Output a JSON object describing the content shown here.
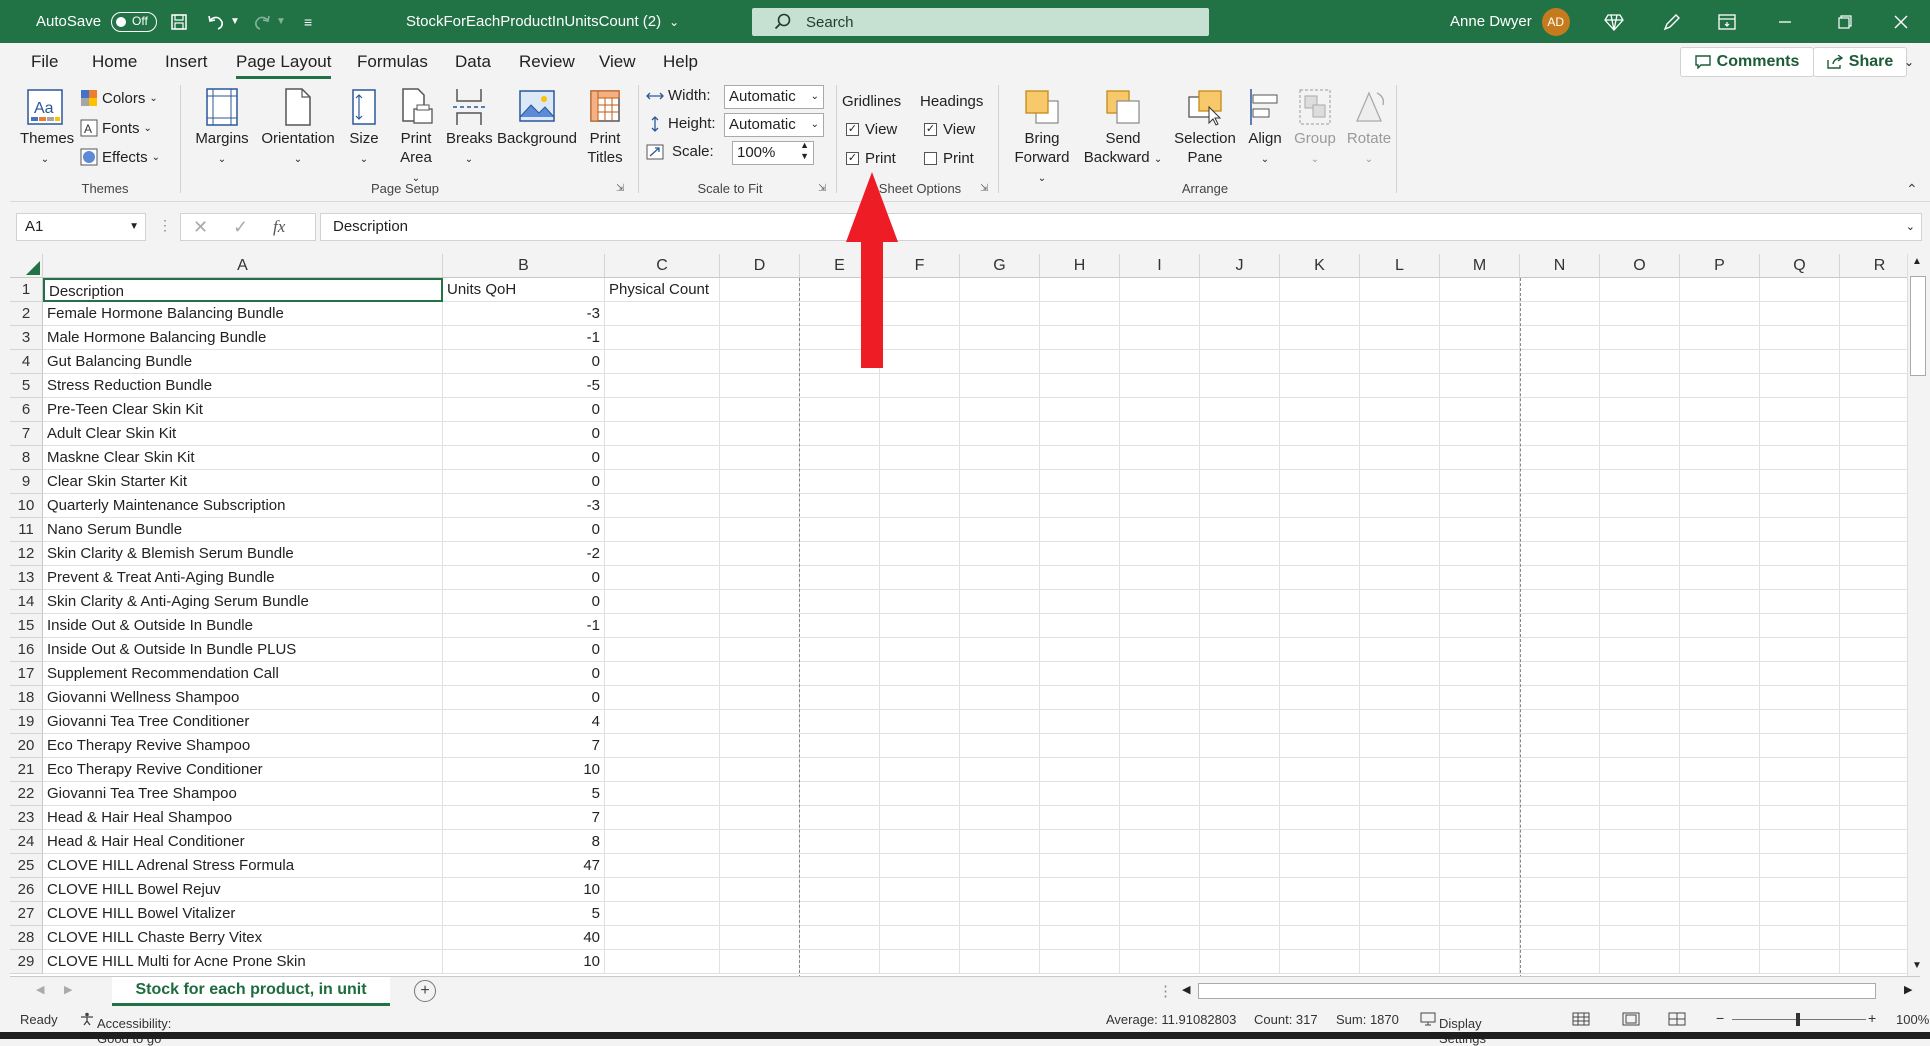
{
  "titlebar": {
    "autosave_label": "AutoSave",
    "autosave_state": "Off",
    "file_name": "StockForEachProductInUnitsCount (2)",
    "search_placeholder": "Search",
    "user_name": "Anne Dwyer",
    "user_initials": "AD"
  },
  "tabs": [
    "File",
    "Home",
    "Insert",
    "Page Layout",
    "Formulas",
    "Data",
    "Review",
    "View",
    "Help"
  ],
  "active_tab": "Page Layout",
  "actions": {
    "comments": "Comments",
    "share": "Share"
  },
  "ribbon": {
    "themes": {
      "themes_btn": "Themes",
      "colors": "Colors",
      "fonts": "Fonts",
      "effects": "Effects",
      "label": "Themes"
    },
    "page_setup": {
      "margins": "Margins",
      "orientation": "Orientation",
      "size": "Size",
      "print_area_1": "Print",
      "print_area_2": "Area",
      "breaks": "Breaks",
      "background": "Background",
      "print_titles_1": "Print",
      "print_titles_2": "Titles",
      "label": "Page Setup"
    },
    "scale_to_fit": {
      "width_label": "Width:",
      "width_value": "Automatic",
      "height_label": "Height:",
      "height_value": "Automatic",
      "scale_label": "Scale:",
      "scale_value": "100%",
      "label": "Scale to Fit"
    },
    "sheet_options": {
      "gridlines": "Gridlines",
      "headings": "Headings",
      "view": "View",
      "print": "Print",
      "label": "Sheet Options"
    },
    "arrange": {
      "bring_1": "Bring",
      "bring_2": "Forward",
      "send_1": "Send",
      "send_2": "Backward",
      "selection_1": "Selection",
      "selection_2": "Pane",
      "align": "Align",
      "group": "Group",
      "rotate": "Rotate",
      "label": "Arrange"
    }
  },
  "formula_bar": {
    "name_box": "A1",
    "fx": "fx",
    "content": "Description"
  },
  "columns": [
    "A",
    "B",
    "C",
    "D",
    "E",
    "F",
    "G",
    "H",
    "I",
    "J",
    "K",
    "L",
    "M",
    "N",
    "O",
    "P",
    "Q",
    "R"
  ],
  "rows": [
    {
      "n": "1",
      "a": "Description",
      "b": "Units QoH",
      "c": "Physical Count"
    },
    {
      "n": "2",
      "a": "Female Hormone Balancing Bundle",
      "b": "-3"
    },
    {
      "n": "3",
      "a": "Male Hormone Balancing Bundle",
      "b": "-1"
    },
    {
      "n": "4",
      "a": "Gut Balancing Bundle",
      "b": "0"
    },
    {
      "n": "5",
      "a": "Stress Reduction Bundle",
      "b": "-5"
    },
    {
      "n": "6",
      "a": "Pre-Teen Clear Skin Kit",
      "b": "0"
    },
    {
      "n": "7",
      "a": "Adult Clear Skin Kit",
      "b": "0"
    },
    {
      "n": "8",
      "a": "Maskne Clear Skin Kit",
      "b": "0"
    },
    {
      "n": "9",
      "a": "Clear Skin Starter Kit",
      "b": "0"
    },
    {
      "n": "10",
      "a": "Quarterly Maintenance Subscription",
      "b": "-3"
    },
    {
      "n": "11",
      "a": "Nano Serum Bundle",
      "b": "0"
    },
    {
      "n": "12",
      "a": "Skin Clarity & Blemish Serum Bundle",
      "b": "-2"
    },
    {
      "n": "13",
      "a": "Prevent & Treat Anti-Aging Bundle",
      "b": "0"
    },
    {
      "n": "14",
      "a": "Skin Clarity & Anti-Aging Serum Bundle",
      "b": "0"
    },
    {
      "n": "15",
      "a": "Inside Out & Outside In Bundle",
      "b": "-1"
    },
    {
      "n": "16",
      "a": "Inside Out & Outside In Bundle PLUS",
      "b": "0"
    },
    {
      "n": "17",
      "a": "Supplement Recommendation Call",
      "b": "0"
    },
    {
      "n": "18",
      "a": "Giovanni Wellness Shampoo",
      "b": "0"
    },
    {
      "n": "19",
      "a": "Giovanni Tea Tree Conditioner",
      "b": "4"
    },
    {
      "n": "20",
      "a": "Eco Therapy Revive Shampoo",
      "b": "7"
    },
    {
      "n": "21",
      "a": "Eco Therapy Revive Conditioner",
      "b": "10"
    },
    {
      "n": "22",
      "a": "Giovanni Tea Tree Shampoo",
      "b": "5"
    },
    {
      "n": "23",
      "a": "Head & Hair Heal Shampoo",
      "b": "7"
    },
    {
      "n": "24",
      "a": "Head & Hair Heal Conditioner",
      "b": "8"
    },
    {
      "n": "25",
      "a": "CLOVE HILL Adrenal Stress Formula",
      "b": "47"
    },
    {
      "n": "26",
      "a": "CLOVE HILL Bowel Rejuv",
      "b": "10"
    },
    {
      "n": "27",
      "a": "CLOVE HILL Bowel Vitalizer",
      "b": "5"
    },
    {
      "n": "28",
      "a": "CLOVE HILL Chaste Berry Vitex",
      "b": "40"
    },
    {
      "n": "29",
      "a": "CLOVE HILL Multi for Acne Prone Skin",
      "b": "10"
    }
  ],
  "sheet_tab": "Stock for each product, in unit",
  "status": {
    "ready": "Ready",
    "accessibility": "Accessibility: Good to go",
    "average": "Average: 11.91082803",
    "count": "Count: 317",
    "sum": "Sum: 1870",
    "display_settings": "Display Settings",
    "zoom": "100%"
  },
  "colors": {
    "brand": "#217346",
    "arrow": "#ee1c25"
  }
}
